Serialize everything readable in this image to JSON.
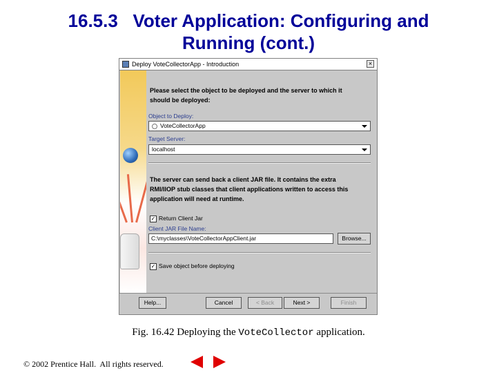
{
  "slide": {
    "title_line1": "16.5.3   Voter Application: Configuring and",
    "title_line2": "Running (cont.)",
    "caption_prefix": "Fig. 16.42 Deploying the ",
    "caption_code": "VoteCollector",
    "caption_suffix": " application.",
    "copyright": "© 2002 Prentice Hall.  All rights reserved.",
    "nav_prev": "previous-arrow-icon",
    "nav_next": "next-arrow-icon"
  },
  "dialog": {
    "title": "Deploy VoteCollectorApp - Introduction",
    "intro": [
      "Please select the object to be deployed and the server to which it",
      "should be deployed:"
    ],
    "object_label": "Object to Deploy:",
    "object_value": "VoteCollectorApp",
    "server_label": "Target Server:",
    "server_value": "localhost",
    "jar_text": [
      "The server can send back a client JAR file. It contains the extra",
      "RMI/IIOP stub classes that client applications written to access this",
      "application will need at runtime."
    ],
    "return_jar_label": "Return Client Jar",
    "return_jar_checked": true,
    "jar_name_label": "Client JAR File Name:",
    "jar_name_value": "C:\\myclasses\\VoteCollectorAppClient.jar",
    "browse_label": "Browse...",
    "save_label": "Save object before deploying",
    "save_checked": true,
    "buttons": {
      "help": "Help...",
      "cancel": "Cancel",
      "back": "< Back",
      "next": "Next >",
      "finish": "Finish"
    },
    "colors": {
      "label_blue": "#2b3d8f",
      "title_blue": "#000099",
      "nav_red": "#e00000"
    }
  }
}
